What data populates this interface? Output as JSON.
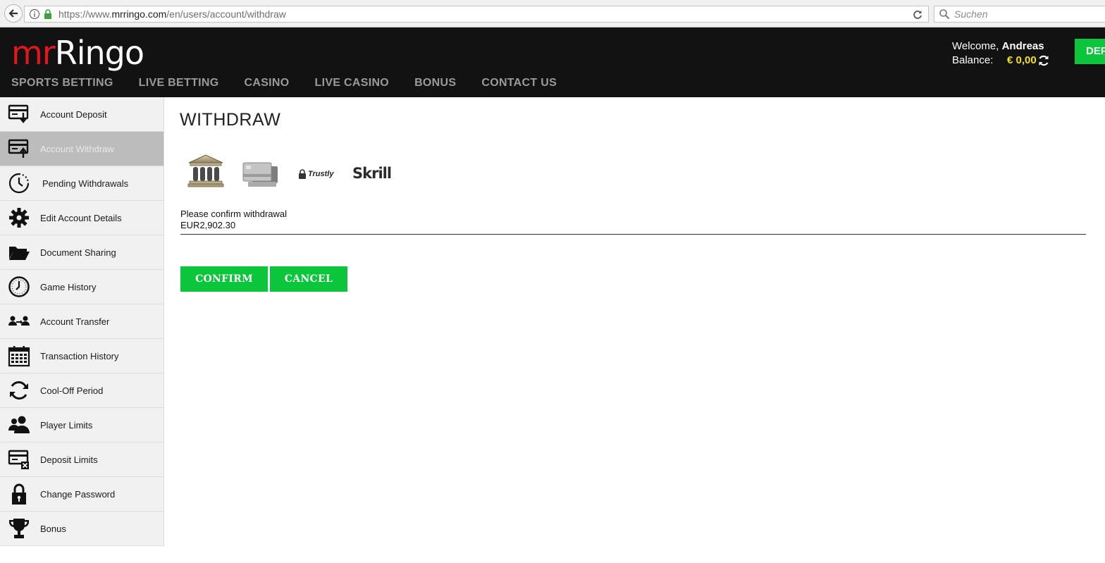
{
  "browser": {
    "url_prefix": "https://www.",
    "url_host": "mrringo.com",
    "url_path": "/en/users/account/withdraw",
    "search_placeholder": "Suchen"
  },
  "header": {
    "logo_mr": "mr",
    "logo_ringo": "Ringo",
    "welcome_label": "Welcome,",
    "username": "Andreas",
    "balance_label": "Balance:",
    "balance_value": "€ 0,00",
    "deposit_button": "DEP"
  },
  "nav": [
    "SPORTS BETTING",
    "LIVE BETTING",
    "CASINO",
    "LIVE CASINO",
    "BONUS",
    "CONTACT US"
  ],
  "sidebar": {
    "items": [
      {
        "label": "Account Deposit",
        "icon": "deposit-icon"
      },
      {
        "label": "Account Withdraw",
        "icon": "withdraw-icon"
      },
      {
        "label": "Pending Withdrawals",
        "icon": "clock-pending-icon"
      },
      {
        "label": "Edit Account Details",
        "icon": "gear-icon"
      },
      {
        "label": "Document Sharing",
        "icon": "folder-icon"
      },
      {
        "label": "Game History",
        "icon": "clock-icon"
      },
      {
        "label": "Account Transfer",
        "icon": "users-transfer-icon"
      },
      {
        "label": "Transaction History",
        "icon": "calendar-icon"
      },
      {
        "label": "Cool-Off Period",
        "icon": "cycle-icon"
      },
      {
        "label": "Player Limits",
        "icon": "players-icon"
      },
      {
        "label": "Deposit Limits",
        "icon": "card-limit-icon"
      },
      {
        "label": "Change Password",
        "icon": "lock-icon"
      },
      {
        "label": "Bonus",
        "icon": "trophy-icon"
      }
    ],
    "active_index": 1
  },
  "main": {
    "title": "WITHDRAW",
    "methods": [
      {
        "name": "bank",
        "icon": "bank-icon"
      },
      {
        "name": "cards",
        "icon": "credit-card-icon"
      },
      {
        "name": "Trustly",
        "icon": "trustly-logo"
      },
      {
        "name": "Skrill",
        "icon": "skrill-logo"
      }
    ],
    "confirm_text": "Please confirm withdrawal",
    "amount": "EUR2,902.30",
    "confirm_button": "CONFIRM",
    "cancel_button": "CANCEL"
  },
  "colors": {
    "brand_green": "#0bc63a",
    "brand_red": "#e3161d",
    "balance_yellow": "#f5e11b",
    "header_bg": "#121212"
  }
}
